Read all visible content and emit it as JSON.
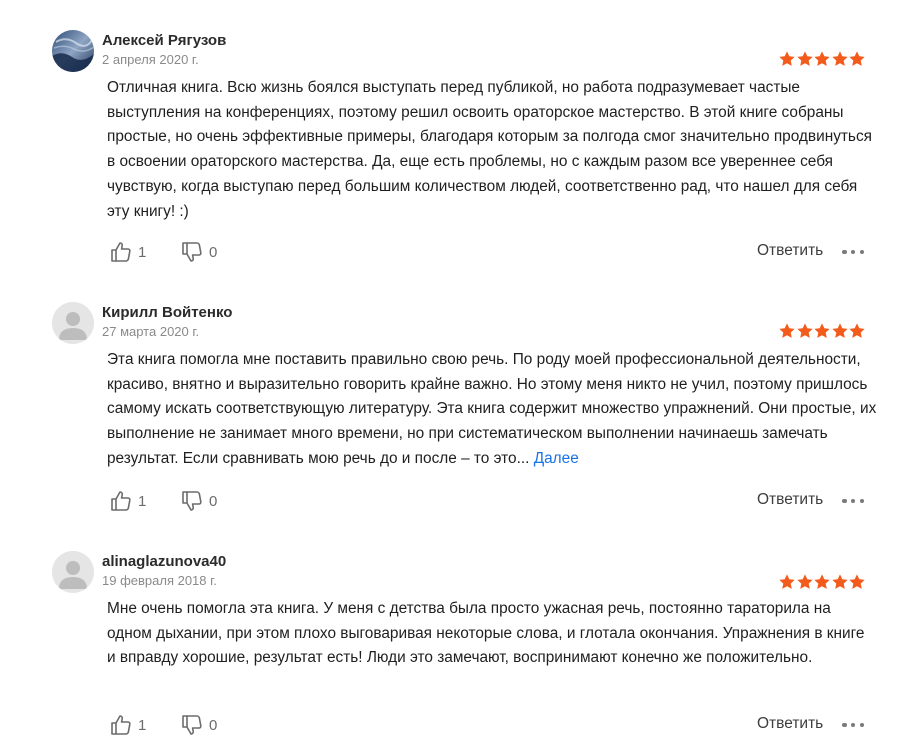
{
  "colors": {
    "star": "#f25b1c",
    "link": "#1a73e8",
    "icon": "#6c6c6c"
  },
  "reviews": [
    {
      "author": "Алексей Рягузов",
      "date": "2 апреля 2020 г.",
      "rating": 5,
      "avatar": "photo",
      "text": "Отличная книга. Всю жизнь боялся выступать перед публикой, но работа подразумевает частые выступления на конференциях, поэтому решил освоить ораторское мастерство. В этой книге собраны простые, но очень эффективные примеры, благодаря которым за полгода смог значительно продвинуться в освоении ораторского мастерства. Да, еще есть проблемы, но с каждым разом все увереннее себя чувствую, когда выступаю перед большим количеством людей, соответственно рад, что нашел для себя эту книгу! :)",
      "more": "",
      "likes": "1",
      "dislikes": "0"
    },
    {
      "author": "Кирилл Войтенко",
      "date": "27 марта 2020 г.",
      "rating": 5,
      "avatar": "placeholder",
      "text": "Эта книга помогла мне поставить правильно свою речь. По роду моей профессиональной деятельности, красиво, внятно и выразительно говорить крайне важно. Но этому меня никто не учил, поэтому пришлось самому искать соответствующую литературу. Эта книга содержит множество упражнений. Они простые, их выполнение не занимает много времени, но при систематическом выполнении начинаешь замечать результат. Если сравнивать мою речь до и после – то это...",
      "more": "Далее",
      "likes": "1",
      "dislikes": "0"
    },
    {
      "author": "alinaglazunova40",
      "date": "19 февраля 2018 г.",
      "rating": 5,
      "avatar": "placeholder",
      "text": "Мне очень помогла эта книга. У меня с детства была просто ужасная речь, постоянно тараторила на одном дыхании, при этом плохо выговаривая некоторые слова, и глотала окончания. Упражнения в книге и вправду хорошие, результат есть! Люди это замечают, воспринимают конечно же положительно.",
      "more": "",
      "likes": "1",
      "dislikes": "0"
    }
  ],
  "actions": {
    "reply_label": "Ответить"
  }
}
